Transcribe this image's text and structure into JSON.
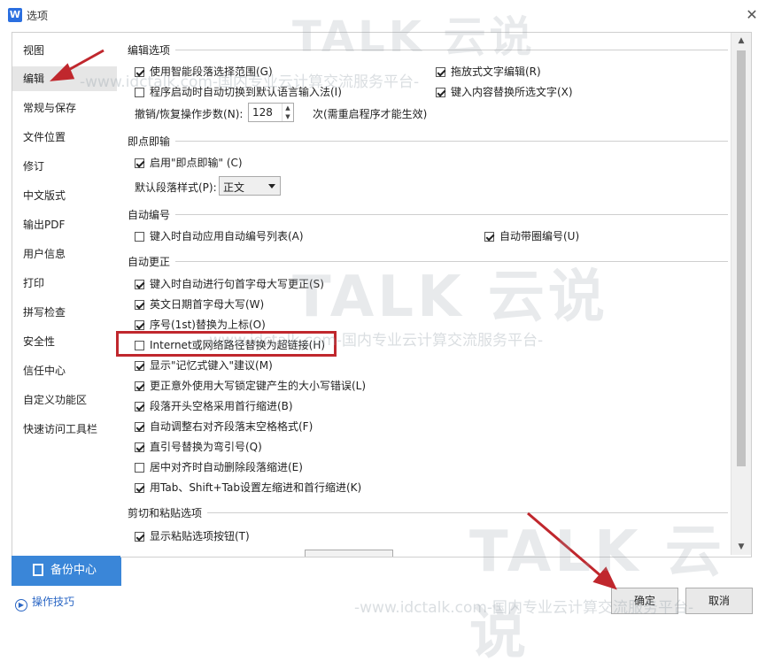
{
  "window": {
    "title": "选项",
    "app_icon": "W",
    "close": "✕"
  },
  "sidebar": {
    "items": [
      {
        "label": "视图"
      },
      {
        "label": "编辑",
        "active": true
      },
      {
        "label": "常规与保存"
      },
      {
        "label": "文件位置"
      },
      {
        "label": "修订"
      },
      {
        "label": "中文版式"
      },
      {
        "label": "输出PDF"
      },
      {
        "label": "用户信息"
      },
      {
        "label": "打印"
      },
      {
        "label": "拼写检查"
      },
      {
        "label": "安全性"
      },
      {
        "label": "信任中心"
      },
      {
        "label": "自定义功能区"
      },
      {
        "label": "快速访问工具栏"
      }
    ],
    "backup": "备份中心",
    "tips": "操作技巧"
  },
  "sections": {
    "edit": {
      "title": "编辑选项",
      "smart_para": {
        "label": "使用智能段落选择范围(G)",
        "checked": true
      },
      "drag_text": {
        "label": "拖放式文字编辑(R)",
        "checked": true
      },
      "auto_ime": {
        "label": "程序启动时自动切换到默认语言输入法(I)",
        "checked": false
      },
      "replace_sel": {
        "label": "键入内容替换所选文字(X)",
        "checked": true
      },
      "undo_label": "撤销/恢复操作步数(N):",
      "undo_value": "128",
      "undo_suffix": "次(需重启程序才能生效)"
    },
    "click_type": {
      "title": "即点即输",
      "enable": {
        "label": "启用\"即点即输\" (C)",
        "checked": true
      },
      "style_label": "默认段落样式(P):",
      "style_value": "正文"
    },
    "auto_number": {
      "title": "自动编号",
      "auto_list": {
        "label": "键入时自动应用自动编号列表(A)",
        "checked": false
      },
      "auto_circle": {
        "label": "自动带圈编号(U)",
        "checked": true
      }
    },
    "auto_correct": {
      "title": "自动更正",
      "items": [
        {
          "label": "键入时自动进行句首字母大写更正(S)",
          "checked": true
        },
        {
          "label": "英文日期首字母大写(W)",
          "checked": true
        },
        {
          "label": "序号(1st)替换为上标(O)",
          "checked": true
        },
        {
          "label": "Internet或网络路径替换为超链接(H)",
          "checked": false
        },
        {
          "label": "显示\"记忆式键入\"建议(M)",
          "checked": true
        },
        {
          "label": "更正意外使用大写锁定键产生的大小写错误(L)",
          "checked": true
        },
        {
          "label": "段落开头空格采用首行缩进(B)",
          "checked": true
        },
        {
          "label": "自动调整右对齐段落末空格格式(F)",
          "checked": true
        },
        {
          "label": "直引号替换为弯引号(Q)",
          "checked": true
        },
        {
          "label": "居中对齐时自动删除段落缩进(E)",
          "checked": false
        },
        {
          "label": "用Tab、Shift+Tab设置左缩进和首行缩进(K)",
          "checked": true
        }
      ]
    },
    "paste": {
      "title": "剪切和粘贴选项",
      "show_btn": {
        "label": "显示粘贴选项按钮(T)",
        "checked": true
      }
    }
  },
  "buttons": {
    "ok": "确定",
    "cancel": "取消"
  },
  "watermark": {
    "big": "TALK 云说",
    "small": "-www.idctalk.com-国内专业云计算交流服务平台-"
  },
  "colors": {
    "annotation_red": "#c0272d",
    "accent_blue": "#3a86d8"
  }
}
